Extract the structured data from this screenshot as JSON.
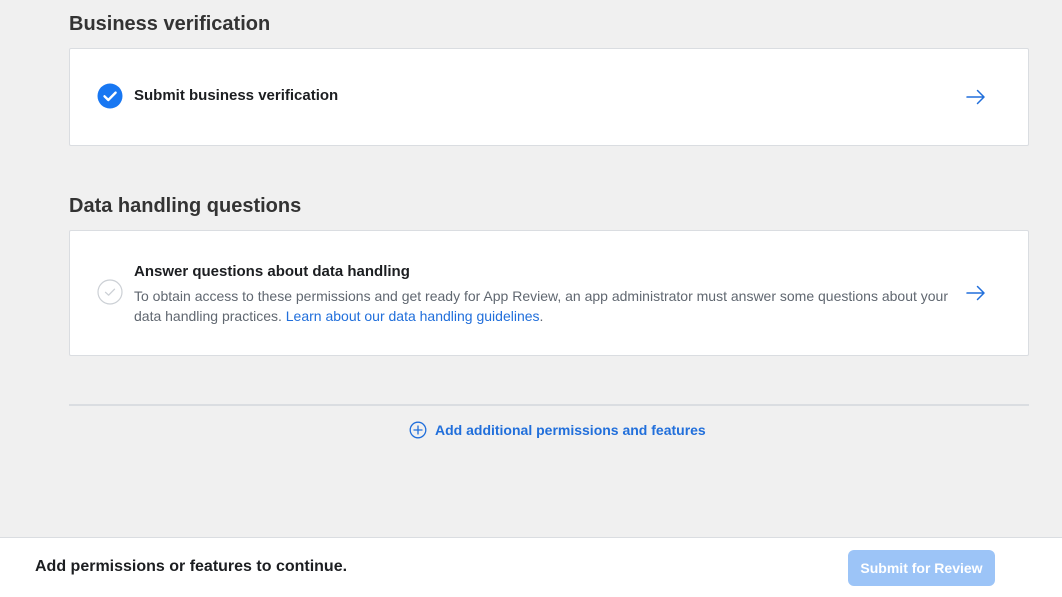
{
  "business_verification": {
    "heading": "Business verification",
    "task": {
      "title": "Submit business verification",
      "status": "complete",
      "status_icon": "check-circle-filled-icon",
      "arrow_icon": "arrow-right-icon"
    }
  },
  "data_handling": {
    "heading": "Data handling questions",
    "task": {
      "title": "Answer questions about data handling",
      "description": "To obtain access to these permissions and get ready for App Review, an app administrator must answer some questions about your data handling practices.",
      "link_text": "Learn about our data handling guidelines",
      "link_suffix": ".",
      "status": "incomplete",
      "status_icon": "check-circle-outline-icon",
      "arrow_icon": "arrow-right-icon"
    }
  },
  "add_more": {
    "label": "Add additional permissions and features",
    "icon": "plus-circle-icon"
  },
  "footer": {
    "message": "Add permissions or features to continue.",
    "submit_label": "Submit for Review",
    "submit_enabled": false
  },
  "colors": {
    "accent": "#216fdb",
    "check_filled": "#1877f2",
    "button_disabled": "#9cc4f7",
    "background": "#f0f0f0",
    "card_border": "#dadde1"
  }
}
